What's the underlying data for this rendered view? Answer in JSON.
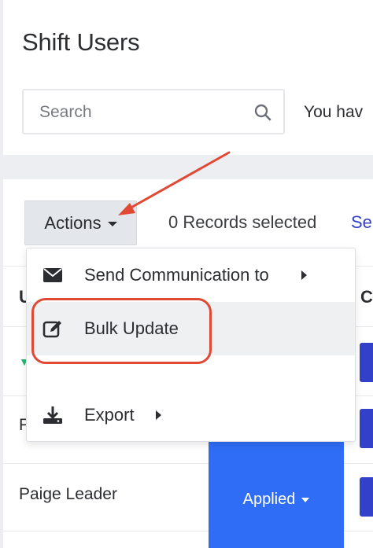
{
  "header": {
    "title": "Shift Users",
    "search_placeholder": "Search",
    "notice_fragment": "You hav"
  },
  "toolbar": {
    "actions_label": "Actions",
    "records_selected": "0 Records selected",
    "select_link_fragment": "Se"
  },
  "table": {
    "header_left_fragment": "U",
    "header_right_fragment": "C",
    "rows": [
      {
        "name": "Paige Leader",
        "status": "Applied"
      }
    ],
    "row_fragment": "P"
  },
  "actions_menu": {
    "items": [
      {
        "label": "Send Communication to",
        "icon": "envelope-icon",
        "has_submenu": true
      },
      {
        "label": "Bulk Update",
        "icon": "edit-icon",
        "has_submenu": false,
        "highlighted": true
      },
      {
        "label": "Export",
        "icon": "download-icon",
        "has_submenu": true
      }
    ]
  },
  "colors": {
    "annotation": "#e04a34",
    "primary_blue": "#2f6df6",
    "link_blue": "#3340c9"
  }
}
